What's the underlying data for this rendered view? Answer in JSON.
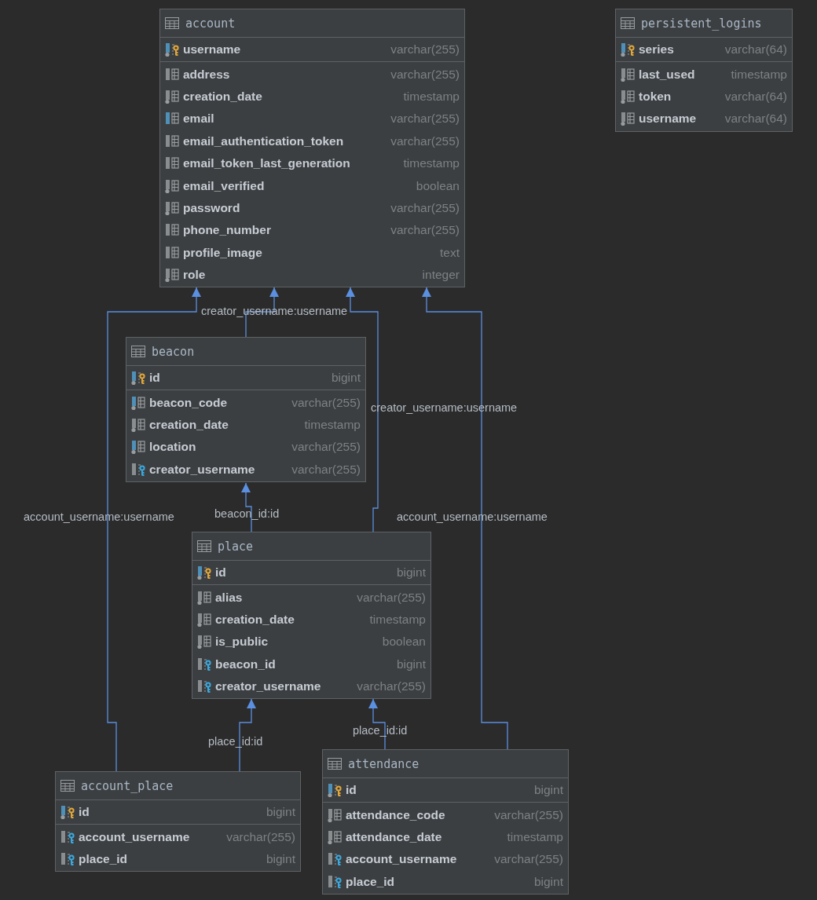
{
  "tables": [
    {
      "name": "account",
      "columns": [
        {
          "name": "username",
          "type": "varchar(255)",
          "kind": "pk",
          "not_null": true,
          "indexed": true
        },
        {
          "name": "address",
          "type": "varchar(255)",
          "kind": "column",
          "not_null": false,
          "indexed": false
        },
        {
          "name": "creation_date",
          "type": "timestamp",
          "kind": "column",
          "not_null": true,
          "indexed": false
        },
        {
          "name": "email",
          "type": "varchar(255)",
          "kind": "column",
          "not_null": false,
          "indexed": true
        },
        {
          "name": "email_authentication_token",
          "type": "varchar(255)",
          "kind": "column",
          "not_null": false,
          "indexed": false
        },
        {
          "name": "email_token_last_generation",
          "type": "timestamp",
          "kind": "column",
          "not_null": false,
          "indexed": false
        },
        {
          "name": "email_verified",
          "type": "boolean",
          "kind": "column",
          "not_null": true,
          "indexed": false
        },
        {
          "name": "password",
          "type": "varchar(255)",
          "kind": "column",
          "not_null": true,
          "indexed": false
        },
        {
          "name": "phone_number",
          "type": "varchar(255)",
          "kind": "column",
          "not_null": false,
          "indexed": false
        },
        {
          "name": "profile_image",
          "type": "text",
          "kind": "column",
          "not_null": false,
          "indexed": false
        },
        {
          "name": "role",
          "type": "integer",
          "kind": "column",
          "not_null": true,
          "indexed": false
        }
      ]
    },
    {
      "name": "persistent_logins",
      "columns": [
        {
          "name": "series",
          "type": "varchar(64)",
          "kind": "pk",
          "not_null": true,
          "indexed": true
        },
        {
          "name": "last_used",
          "type": "timestamp",
          "kind": "column",
          "not_null": true,
          "indexed": false
        },
        {
          "name": "token",
          "type": "varchar(64)",
          "kind": "column",
          "not_null": true,
          "indexed": false
        },
        {
          "name": "username",
          "type": "varchar(64)",
          "kind": "column",
          "not_null": true,
          "indexed": false
        }
      ]
    },
    {
      "name": "beacon",
      "columns": [
        {
          "name": "id",
          "type": "bigint",
          "kind": "pk",
          "not_null": true,
          "indexed": true
        },
        {
          "name": "beacon_code",
          "type": "varchar(255)",
          "kind": "column",
          "not_null": true,
          "indexed": true
        },
        {
          "name": "creation_date",
          "type": "timestamp",
          "kind": "column",
          "not_null": true,
          "indexed": false
        },
        {
          "name": "location",
          "type": "varchar(255)",
          "kind": "column",
          "not_null": true,
          "indexed": true
        },
        {
          "name": "creator_username",
          "type": "varchar(255)",
          "kind": "fk",
          "not_null": false,
          "indexed": false
        }
      ]
    },
    {
      "name": "place",
      "columns": [
        {
          "name": "id",
          "type": "bigint",
          "kind": "pk",
          "not_null": true,
          "indexed": true
        },
        {
          "name": "alias",
          "type": "varchar(255)",
          "kind": "column",
          "not_null": true,
          "indexed": false
        },
        {
          "name": "creation_date",
          "type": "timestamp",
          "kind": "column",
          "not_null": true,
          "indexed": false
        },
        {
          "name": "is_public",
          "type": "boolean",
          "kind": "column",
          "not_null": true,
          "indexed": false
        },
        {
          "name": "beacon_id",
          "type": "bigint",
          "kind": "fk",
          "not_null": false,
          "indexed": false
        },
        {
          "name": "creator_username",
          "type": "varchar(255)",
          "kind": "fk",
          "not_null": false,
          "indexed": false
        }
      ]
    },
    {
      "name": "account_place",
      "columns": [
        {
          "name": "id",
          "type": "bigint",
          "kind": "pk",
          "not_null": true,
          "indexed": true
        },
        {
          "name": "account_username",
          "type": "varchar(255)",
          "kind": "fk",
          "not_null": false,
          "indexed": false
        },
        {
          "name": "place_id",
          "type": "bigint",
          "kind": "fk",
          "not_null": false,
          "indexed": false
        }
      ]
    },
    {
      "name": "attendance",
      "columns": [
        {
          "name": "id",
          "type": "bigint",
          "kind": "pk",
          "not_null": true,
          "indexed": true
        },
        {
          "name": "attendance_code",
          "type": "varchar(255)",
          "kind": "column",
          "not_null": true,
          "indexed": false
        },
        {
          "name": "attendance_date",
          "type": "timestamp",
          "kind": "column",
          "not_null": true,
          "indexed": false
        },
        {
          "name": "account_username",
          "type": "varchar(255)",
          "kind": "fk",
          "not_null": false,
          "indexed": false
        },
        {
          "name": "place_id",
          "type": "bigint",
          "kind": "fk",
          "not_null": false,
          "indexed": false
        }
      ]
    }
  ],
  "relations": [
    {
      "label": "creator_username:username"
    },
    {
      "label": "creator_username:username"
    },
    {
      "label": "account_username:username"
    },
    {
      "label": "beacon_id:id"
    },
    {
      "label": "account_username:username"
    },
    {
      "label": "place_id:id"
    },
    {
      "label": "place_id:id"
    }
  ]
}
